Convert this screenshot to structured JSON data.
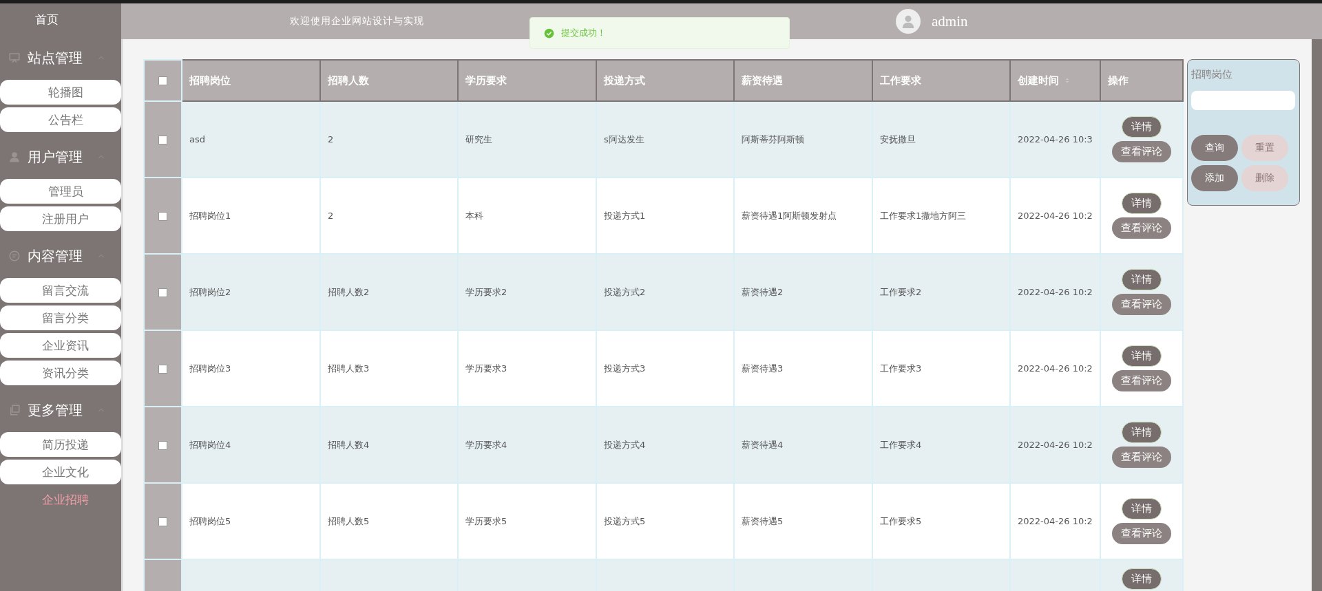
{
  "sidebar": {
    "home": "首页",
    "groups": [
      {
        "title": "站点管理",
        "expanded": true,
        "items": [
          {
            "label": "轮播图",
            "selected": false
          },
          {
            "label": "公告栏",
            "selected": false
          }
        ]
      },
      {
        "title": "用户管理",
        "expanded": true,
        "items": [
          {
            "label": "管理员",
            "selected": false
          },
          {
            "label": "注册用户",
            "selected": false
          }
        ]
      },
      {
        "title": "内容管理",
        "expanded": true,
        "items": [
          {
            "label": "留言交流",
            "selected": false
          },
          {
            "label": "留言分类",
            "selected": false
          },
          {
            "label": "企业资讯",
            "selected": false
          },
          {
            "label": "资讯分类",
            "selected": false
          }
        ]
      },
      {
        "title": "更多管理",
        "expanded": true,
        "items": [
          {
            "label": "简历投递",
            "selected": false
          },
          {
            "label": "企业文化",
            "selected": false
          },
          {
            "label": "企业招聘",
            "selected": true
          }
        ]
      }
    ]
  },
  "header": {
    "title": "欢迎使用企业网站设计与实现",
    "user": "admin"
  },
  "toast": {
    "message": "提交成功！"
  },
  "table": {
    "select_all_checked": false,
    "columns": [
      {
        "label": "招聘岗位",
        "sortable": false
      },
      {
        "label": "招聘人数",
        "sortable": false
      },
      {
        "label": "学历要求",
        "sortable": false
      },
      {
        "label": "投递方式",
        "sortable": false
      },
      {
        "label": "薪资待遇",
        "sortable": false
      },
      {
        "label": "工作要求",
        "sortable": false
      },
      {
        "label": "创建时间",
        "sortable": true
      },
      {
        "label": "操作",
        "sortable": false
      }
    ],
    "rows": [
      {
        "checked": false,
        "cells": [
          "asd",
          "2",
          "研究生",
          "s阿达发生",
          "阿斯蒂芬阿斯顿",
          "安抚撒旦",
          "2022-04-26 10:3"
        ],
        "actions": [
          "详情",
          "查看评论"
        ]
      },
      {
        "checked": false,
        "cells": [
          "招聘岗位1",
          "2",
          "本科",
          "投递方式1",
          "薪资待遇1阿斯顿发射点",
          "工作要求1撒地方阿三",
          "2022-04-26 10:2"
        ],
        "actions": [
          "详情",
          "查看评论"
        ]
      },
      {
        "checked": false,
        "cells": [
          "招聘岗位2",
          "招聘人数2",
          "学历要求2",
          "投递方式2",
          "薪资待遇2",
          "工作要求2",
          "2022-04-26 10:2"
        ],
        "actions": [
          "详情",
          "查看评论"
        ]
      },
      {
        "checked": false,
        "cells": [
          "招聘岗位3",
          "招聘人数3",
          "学历要求3",
          "投递方式3",
          "薪资待遇3",
          "工作要求3",
          "2022-04-26 10:2"
        ],
        "actions": [
          "详情",
          "查看评论"
        ]
      },
      {
        "checked": false,
        "cells": [
          "招聘岗位4",
          "招聘人数4",
          "学历要求4",
          "投递方式4",
          "薪资待遇4",
          "工作要求4",
          "2022-04-26 10:2"
        ],
        "actions": [
          "详情",
          "查看评论"
        ]
      },
      {
        "checked": false,
        "cells": [
          "招聘岗位5",
          "招聘人数5",
          "学历要求5",
          "投递方式5",
          "薪资待遇5",
          "工作要求5",
          "2022-04-26 10:2"
        ],
        "actions": [
          "详情",
          "查看评论"
        ]
      }
    ],
    "cut_row": {
      "actions": [
        "详情"
      ]
    }
  },
  "search_panel": {
    "label": "招聘岗位",
    "buttons": [
      {
        "label": "查询",
        "kind": "dark"
      },
      {
        "label": "重置",
        "kind": "light"
      },
      {
        "label": "添加",
        "kind": "dark"
      },
      {
        "label": "删除",
        "kind": "light"
      }
    ]
  }
}
